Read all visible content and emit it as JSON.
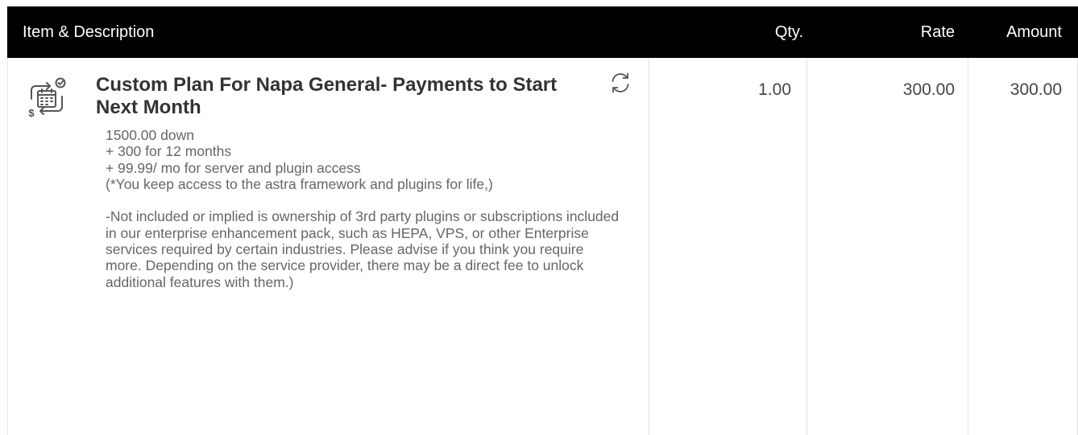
{
  "table": {
    "headers": {
      "item": "Item & Description",
      "qty": "Qty.",
      "rate": "Rate",
      "amount": "Amount"
    },
    "rows": [
      {
        "icon": "calendar-payment-icon",
        "recurring_icon": "refresh-icon",
        "title": "Custom Plan For Napa General- Payments to Start Next Month",
        "description": "1500.00 down\n+ 300 for 12 months\n+ 99.99/ mo for server and plugin access\n(*You keep access to the astra framework and plugins for life,)\n\n-Not included or implied is ownership of 3rd party plugins or subscriptions included in our enterprise enhancement pack, such as HEPA, VPS, or other Enterprise services required by certain industries. Please advise if you think you require more. Depending on the service provider, there may be a direct fee to unlock additional features with them.)",
        "qty": "1.00",
        "rate": "300.00",
        "amount": "300.00"
      }
    ]
  },
  "colors": {
    "header_bg": "#000000",
    "header_text": "#ffffff",
    "title_text": "#333333",
    "description_text": "#666666",
    "grid_line": "#e3e3e3"
  }
}
